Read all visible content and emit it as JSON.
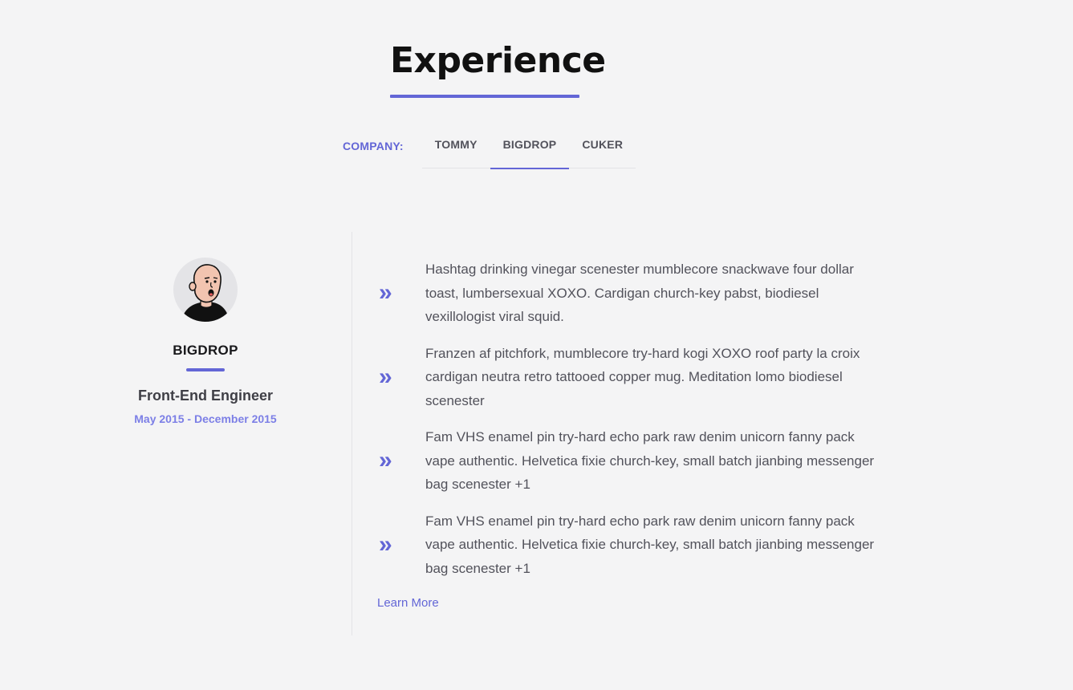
{
  "section": {
    "title": "Experience"
  },
  "company_selector": {
    "label": "COMPANY:",
    "tabs": [
      {
        "label": "TOMMY",
        "active": false
      },
      {
        "label": "BIGDROP",
        "active": true
      },
      {
        "label": "CUKER",
        "active": false
      }
    ]
  },
  "profile": {
    "avatar_icon": "person-avatar-icon",
    "company": "BIGDROP",
    "role": "Front-End Engineer",
    "dates": "May 2015 - December 2015"
  },
  "duties": {
    "bullet_icon": "double-chevron-right-icon",
    "items": [
      "Hashtag drinking vinegar scenester mumblecore snackwave four dollar toast, lumbersexual XOXO. Cardigan church-key pabst, biodiesel vexillologist viral squid.",
      "Franzen af pitchfork, mumblecore try-hard kogi XOXO roof party la croix cardigan neutra retro tattooed copper mug. Meditation lomo biodiesel scenester",
      "Fam VHS enamel pin try-hard echo park raw denim unicorn fanny pack vape authentic. Helvetica fixie church-key, small batch jianbing messenger bag scenester +1",
      "Fam VHS enamel pin try-hard echo park raw denim unicorn fanny pack vape authentic. Helvetica fixie church-key, small batch jianbing messenger bag scenester +1"
    ],
    "learn_more": "Learn More"
  },
  "colors": {
    "accent": "#6366d6",
    "accent_light": "#7c7fe6",
    "background": "#f4f4f5",
    "text": "#52525b"
  }
}
